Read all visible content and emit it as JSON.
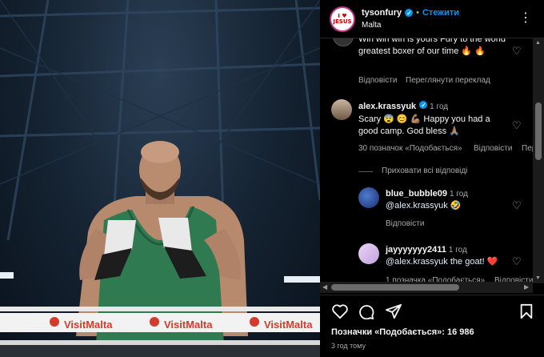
{
  "post": {
    "username": "tysonfury",
    "follow_label": "Стежити",
    "location": "Malta",
    "dot": "•",
    "avatar_logo": "I ♥ JESUS"
  },
  "photo": {
    "banner_text": "VisitMalta"
  },
  "comments": [
    {
      "text": "Win win win is yours Fury to the world greatest boxer of our time 🔥 🔥",
      "reply_label": "Відповісти",
      "translate_label": "Переглянути переклад"
    },
    {
      "username": "alex.krassyuk",
      "time": "1 год",
      "text": "Scary 😨 😊 💪🏽 Happy you had a good camp. God bless 🙏🏽",
      "likes_label": "30 позначок «Подобається»",
      "reply_label": "Відповісти",
      "translate_label": "Переглянути переклад",
      "hide_replies_label": "Приховати всі відповіді"
    },
    {
      "username": "blue_bubble09",
      "time": "1 год",
      "text": "@alex.krassyuk 🤣",
      "reply_label": "Відповісти"
    },
    {
      "username": "jayyyyyyy2411",
      "time": "1 год",
      "text": "@alex.krassyuk the goat! ❤️",
      "likes_label": "1 позначка «Подобається»",
      "reply_label": "Відповісти"
    }
  ],
  "actions": {
    "likes_text": "Позначки «Подобається»: 16 986",
    "time_ago": "3 год тому"
  },
  "colors": {
    "accent": "#0095f6",
    "background": "#000000",
    "heart_red": "#ed4956"
  }
}
